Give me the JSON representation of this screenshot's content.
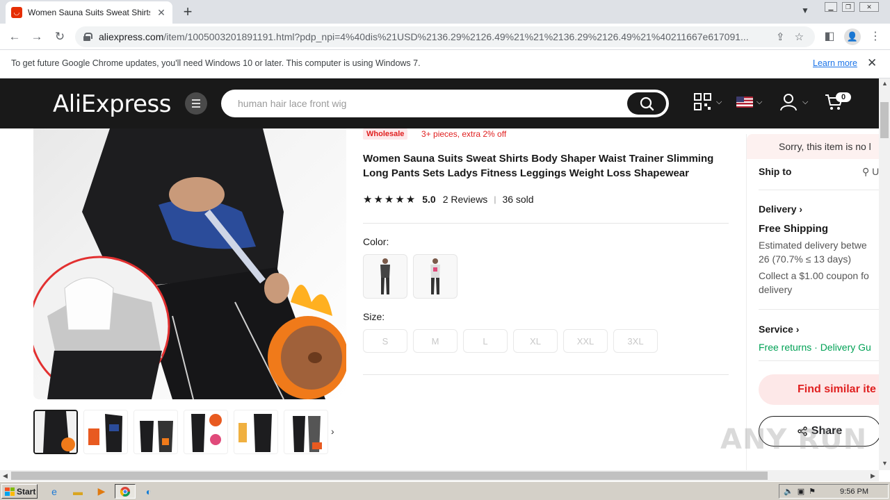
{
  "browser": {
    "tab_title": "Women Sauna Suits Sweat Shirts Bo",
    "url_host": "aliexpress.com",
    "url_path": "/item/1005003201891191.html?pdp_npi=4%40dis%21USD%2136.29%2126.49%21%21%2136.29%2126.49%21%40211667e617091...",
    "infobar_text": "To get future Google Chrome updates, you'll need Windows 10 or later. This computer is using Windows 7.",
    "infobar_link": "Learn more"
  },
  "header": {
    "logo": "AliExpress",
    "search_placeholder": "human hair lace front wig",
    "cart_count": "0"
  },
  "product": {
    "wholesale_badge": "Wholesale",
    "wholesale_offer": "3+ pieces, extra 2% off",
    "title": "Women Sauna Suits Sweat Shirts Body Shaper Waist Trainer Slimming Long Pants Sets Ladys Fitness Leggings Weight Loss Shapewear",
    "rating": "5.0",
    "reviews": "2 Reviews",
    "sold": "36 sold",
    "color_label": "Color:",
    "size_label": "Size:",
    "sizes": [
      "S",
      "M",
      "L",
      "XL",
      "XXL",
      "3XL"
    ]
  },
  "side": {
    "sorry": "Sorry, this item is no l",
    "ship_to": "Ship to",
    "delivery": "Delivery",
    "free_shipping": "Free Shipping",
    "est_1": "Estimated delivery betwe",
    "est_2": "26 (70.7% ≤ 13 days)",
    "coupon_1": "Collect a $1.00 coupon fo",
    "coupon_2": "delivery",
    "service": "Service",
    "service_value": "Free returns · Delivery Gu",
    "find_similar": "Find similar ite",
    "share": "Share"
  },
  "watermark": "ANY RUN",
  "taskbar": {
    "start": "Start",
    "clock": "9:56 PM"
  }
}
